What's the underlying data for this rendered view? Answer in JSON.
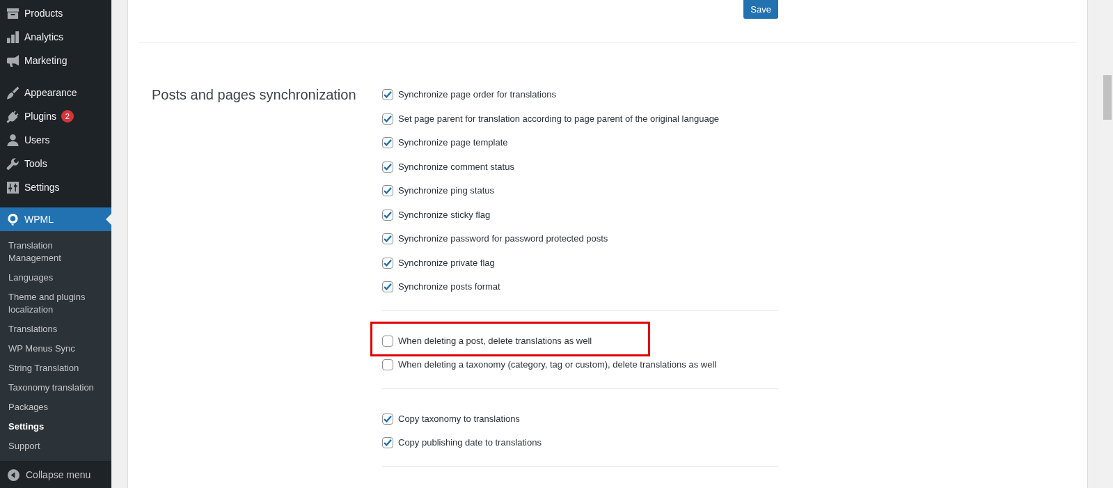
{
  "sidebar": {
    "menu_groups": [
      [
        {
          "label": "Products",
          "selected": false
        },
        {
          "label": "Analytics",
          "selected": false
        },
        {
          "label": "Marketing",
          "selected": false
        }
      ],
      [
        {
          "label": "Appearance",
          "selected": false
        },
        {
          "label": "Plugins",
          "selected": false,
          "badge": "2"
        },
        {
          "label": "Users",
          "selected": false
        },
        {
          "label": "Tools",
          "selected": false
        },
        {
          "label": "Settings",
          "selected": false
        }
      ],
      [
        {
          "label": "WPML",
          "selected": true
        }
      ]
    ],
    "submenu": [
      {
        "label": "Translation Management",
        "selected": false
      },
      {
        "label": "Languages",
        "selected": false
      },
      {
        "label": "Theme and plugins localization",
        "selected": false
      },
      {
        "label": "Translations",
        "selected": false
      },
      {
        "label": "WP Menus Sync",
        "selected": false
      },
      {
        "label": "String Translation",
        "selected": false
      },
      {
        "label": "Taxonomy translation",
        "selected": false
      },
      {
        "label": "Packages",
        "selected": false
      },
      {
        "label": "Settings",
        "selected": true
      },
      {
        "label": "Support",
        "selected": false
      }
    ],
    "collapse": "Collapse menu"
  },
  "save_button": "Save",
  "section": {
    "title": "Posts and pages synchronization",
    "groups": [
      [
        {
          "label": "Synchronize page order for translations",
          "checked": true,
          "highlighted": false
        },
        {
          "label": "Set page parent for translation according to page parent of the original language",
          "checked": true,
          "highlighted": false
        },
        {
          "label": "Synchronize page template",
          "checked": true,
          "highlighted": false
        },
        {
          "label": "Synchronize comment status",
          "checked": true,
          "highlighted": false
        },
        {
          "label": "Synchronize ping status",
          "checked": true,
          "highlighted": false
        },
        {
          "label": "Synchronize sticky flag",
          "checked": true,
          "highlighted": false
        },
        {
          "label": "Synchronize password for password protected posts",
          "checked": true,
          "highlighted": false
        },
        {
          "label": "Synchronize private flag",
          "checked": true,
          "highlighted": false
        },
        {
          "label": "Synchronize posts format",
          "checked": true,
          "highlighted": false
        }
      ],
      [
        {
          "label": "When deleting a post, delete translations as well",
          "checked": false,
          "highlighted": true
        },
        {
          "label": "When deleting a taxonomy (category, tag or custom), delete translations as well",
          "checked": false,
          "highlighted": false
        }
      ],
      [
        {
          "label": "Copy taxonomy to translations",
          "checked": true,
          "highlighted": false
        },
        {
          "label": "Copy publishing date to translations",
          "checked": true,
          "highlighted": false
        }
      ]
    ]
  }
}
